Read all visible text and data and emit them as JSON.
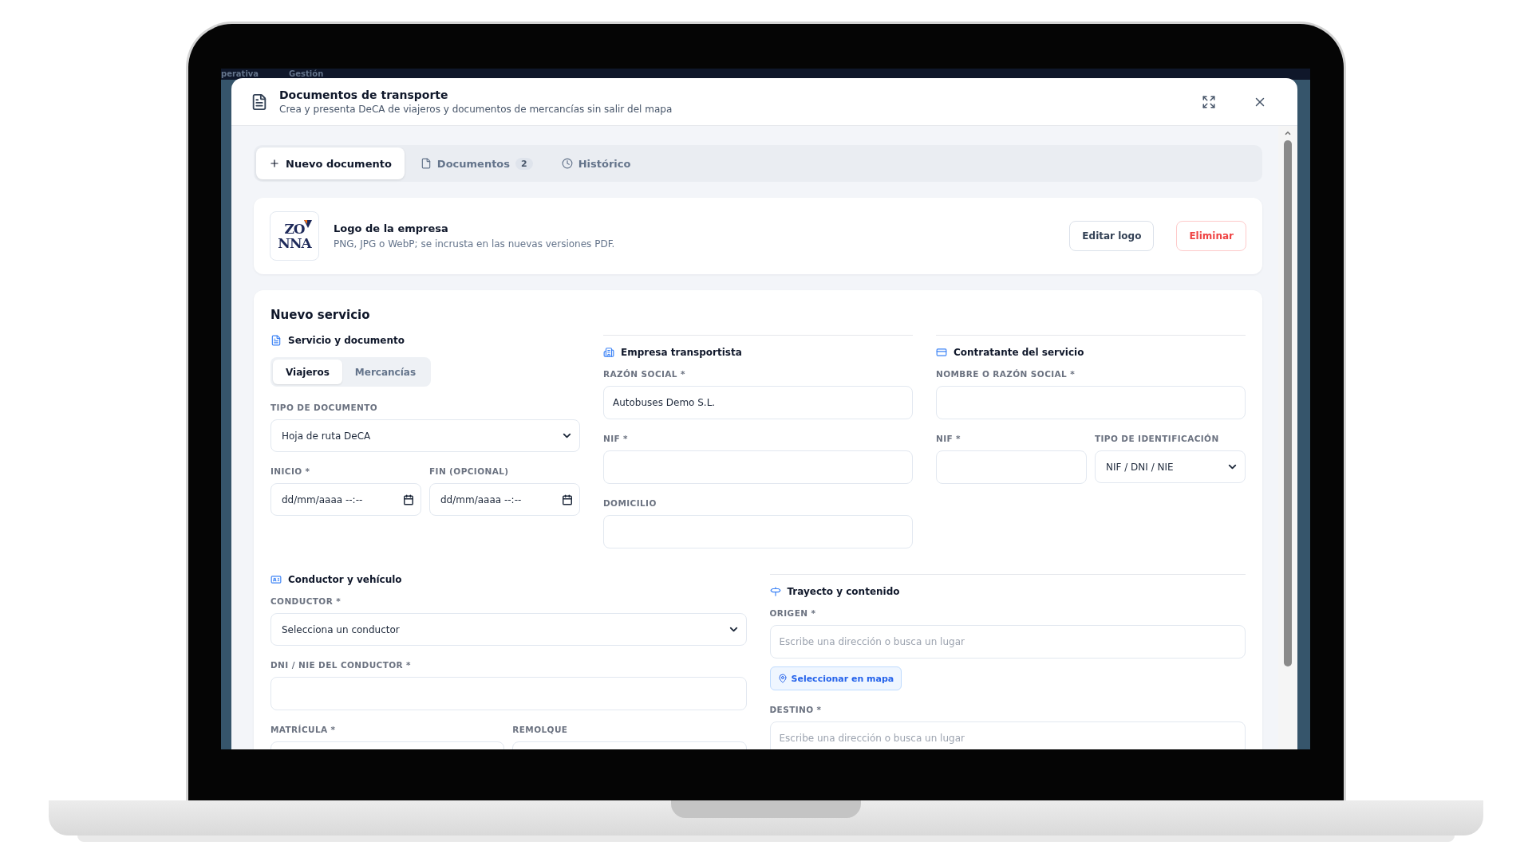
{
  "background_nav": [
    "perativa",
    "Gestión"
  ],
  "modal": {
    "title": "Documentos de transporte",
    "subtitle": "Crea y presenta DeCA de viajeros y documentos de mercancías sin salir del mapa"
  },
  "tabs": [
    {
      "label": "Nuevo documento",
      "selected": true
    },
    {
      "label": "Documentos",
      "badge": "2",
      "selected": false
    },
    {
      "label": "Histórico",
      "selected": false
    }
  ],
  "logo_card": {
    "logo_text": [
      "ZO",
      "NNA"
    ],
    "title": "Logo de la empresa",
    "description": "PNG, JPG o WebP; se incrusta en las nuevas versiones PDF.",
    "buttons": [
      {
        "label": "Editar logo",
        "kind": "default"
      },
      {
        "label": "Eliminar",
        "kind": "danger"
      }
    ]
  },
  "service": {
    "title": "Nuevo servicio",
    "section_rows": [
      [
        {
          "title": "Servicio y documento",
          "segments": [
            {
              "label": "Viajeros",
              "selected": true
            },
            {
              "label": "Mercancías",
              "selected": false
            }
          ],
          "rows": [
            [
              {
                "label": "TIPO DE DOCUMENTO",
                "kind": "select",
                "value": "Hoja de ruta DeCA"
              }
            ],
            [
              {
                "label": "INICIO *",
                "kind": "date",
                "placeholder": "dd/mm/aaaa --:--"
              },
              {
                "label": "FIN (OPCIONAL)",
                "kind": "date",
                "placeholder": "dd/mm/aaaa --:--"
              }
            ]
          ]
        },
        {
          "title": "Empresa transportista",
          "rows": [
            [
              {
                "label": "RAZÓN SOCIAL *",
                "kind": "text",
                "value": "Autobuses Demo S.L."
              }
            ],
            [
              {
                "label": "NIF *",
                "kind": "text"
              }
            ],
            [
              {
                "label": "DOMICILIO",
                "kind": "text"
              }
            ]
          ]
        },
        {
          "title": "Contratante del servicio",
          "rows": [
            [
              {
                "label": "NOMBRE O RAZÓN SOCIAL *",
                "kind": "text"
              }
            ],
            [
              {
                "label": "NIF *",
                "kind": "text"
              },
              {
                "label": "TIPO DE IDENTIFICACIÓN",
                "kind": "select",
                "value": "NIF / DNI / NIE"
              }
            ]
          ]
        }
      ],
      [
        {
          "title": "Conductor y vehículo",
          "rows": [
            [
              {
                "label": "CONDUCTOR *",
                "kind": "select",
                "value": "Selecciona un conductor"
              }
            ],
            [
              {
                "label": "DNI / NIE DEL CONDUCTOR *",
                "kind": "text"
              }
            ],
            [
              {
                "label": "MATRÍCULA *",
                "kind": "text"
              },
              {
                "label": "REMOLQUE",
                "kind": "text"
              }
            ]
          ]
        },
        {
          "title": "Trayecto y contenido",
          "rows": [
            [
              {
                "label": "ORIGEN *",
                "kind": "text",
                "placeholder": "Escribe una dirección o busca un lugar",
                "action": "Seleccionar en mapa"
              }
            ],
            [
              {
                "label": "DESTINO *",
                "kind": "text",
                "placeholder": "Escribe una dirección o busca un lugar"
              }
            ]
          ]
        }
      ]
    ]
  }
}
